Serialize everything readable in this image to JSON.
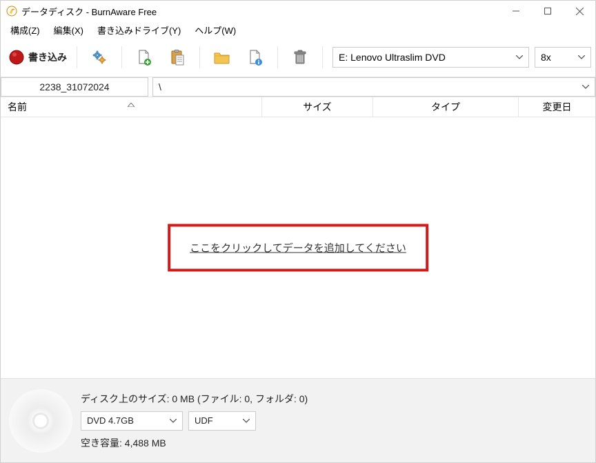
{
  "window": {
    "title": "データディスク - BurnAware Free"
  },
  "menubar": {
    "compose": "構成(Z)",
    "edit": "編集(X)",
    "drive": "書き込みドライブ(Y)",
    "help": "ヘルプ(W)"
  },
  "toolbar": {
    "burn_label": "書き込み",
    "drive_selected": "E: Lenovo Ultraslim DVD",
    "speed_selected": "8x"
  },
  "project": {
    "name": "2238_31072024",
    "path": "\\"
  },
  "columns": {
    "name": "名前",
    "size": "サイズ",
    "type": "タイプ",
    "date": "変更日"
  },
  "files": {
    "add_hint": "ここをクリックしてデータを追加してください"
  },
  "status": {
    "disc_size_line": "ディスク上のサイズ: 0 MB (ファイル: 0, フォルダ: 0)",
    "disc_type_selected": "DVD 4.7GB",
    "fs_selected": "UDF",
    "free_space_line": "空き容量: 4,488 MB"
  }
}
